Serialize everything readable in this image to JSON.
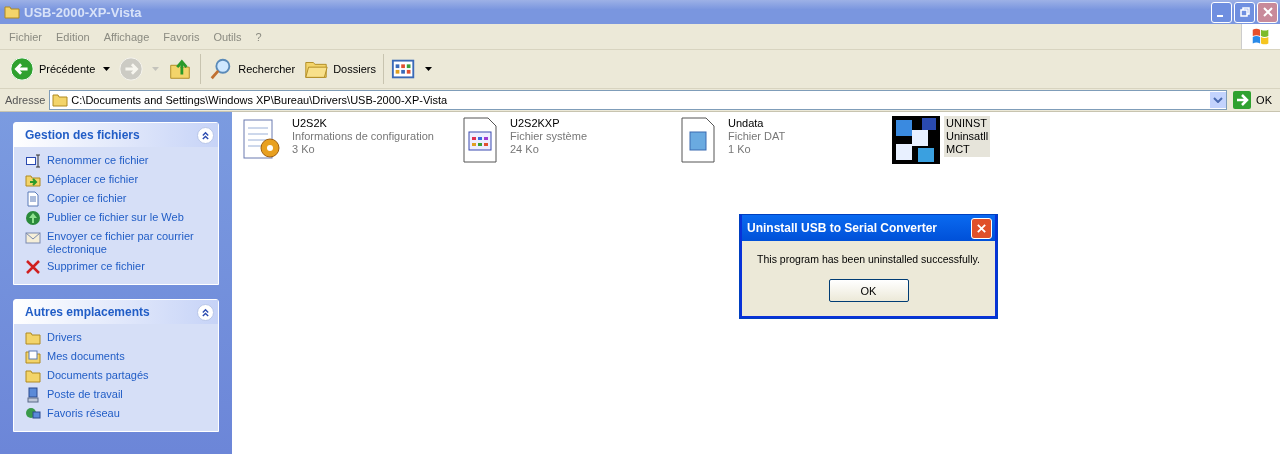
{
  "window": {
    "title": "USB-2000-XP-Vista",
    "active": false
  },
  "menu": [
    "Fichier",
    "Edition",
    "Affichage",
    "Favoris",
    "Outils",
    "?"
  ],
  "toolbar": [
    {
      "kind": "back",
      "label": "Précédente",
      "disabled": false
    },
    {
      "kind": "forward",
      "disabled": true
    },
    {
      "kind": "up",
      "disabled": false
    },
    {
      "kind": "search",
      "label": "Rechercher",
      "disabled": false
    },
    {
      "kind": "folders",
      "label": "Dossiers",
      "disabled": false
    },
    {
      "kind": "views",
      "disabled": false
    }
  ],
  "address": {
    "label": "Adresse",
    "value": "C:\\Documents and Settings\\Windows XP\\Bureau\\Drivers\\USB-2000-XP-Vista",
    "go": "OK"
  },
  "panels": [
    {
      "title": "Gestion des fichiers",
      "expanded": true,
      "items": [
        {
          "kind": "rename",
          "label": "Renommer ce fichier"
        },
        {
          "kind": "move",
          "label": "Déplacer ce fichier"
        },
        {
          "kind": "copy",
          "label": "Copier ce fichier"
        },
        {
          "kind": "publish",
          "label": "Publier ce fichier sur le Web"
        },
        {
          "kind": "email",
          "label": "Envoyer ce fichier par courrier électronique"
        },
        {
          "kind": "delete",
          "label": "Supprimer ce fichier"
        }
      ]
    },
    {
      "title": "Autres emplacements",
      "expanded": true,
      "items": [
        {
          "kind": "folder",
          "label": "Drivers"
        },
        {
          "kind": "documents",
          "label": "Mes documents"
        },
        {
          "kind": "folder",
          "label": "Documents partagés"
        },
        {
          "kind": "computer",
          "label": "Poste de travail"
        },
        {
          "kind": "network",
          "label": "Favoris réseau"
        }
      ]
    }
  ],
  "files": [
    {
      "kind": "config",
      "name": "U2S2K",
      "type": "Informations de configuration",
      "size": "3 Ko",
      "selected": false
    },
    {
      "kind": "system",
      "name": "U2S2KXP",
      "type": "Fichier système",
      "size": "24 Ko",
      "selected": false
    },
    {
      "kind": "dat",
      "name": "Undata",
      "type": "Fichier DAT",
      "size": "1 Ko",
      "selected": false
    },
    {
      "kind": "app",
      "name": "UNINST",
      "type": "Uninsatll",
      "size": "MCT",
      "selected": true
    }
  ],
  "dialog": {
    "title": "Uninstall USB to Serial Converter",
    "message": "This program has been uninstalled successfully.",
    "button": "OK"
  }
}
